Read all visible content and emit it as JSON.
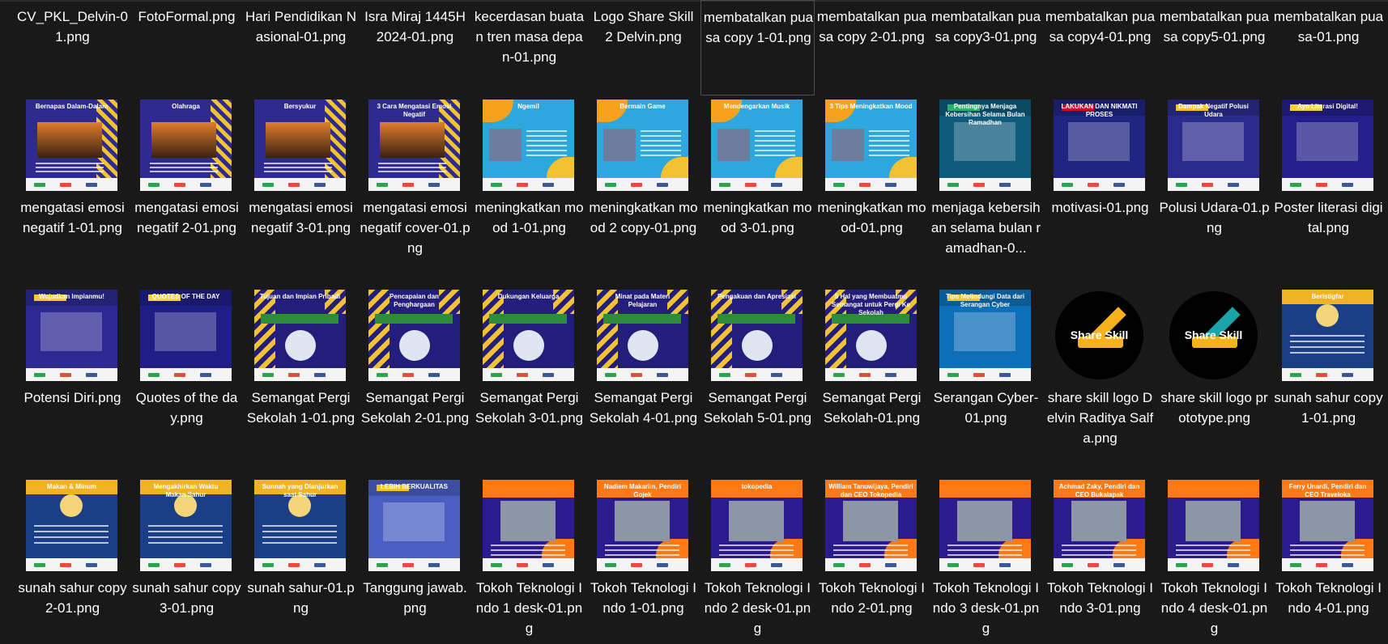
{
  "colors": {
    "background": "#191919",
    "text": "#ffffff",
    "selected_border": "#4d4d4d"
  },
  "top_row": [
    {
      "name": "CV_PKL_Delvin-01.png"
    },
    {
      "name": "FotoFormal.png"
    },
    {
      "name": "Hari Pendidikan Nasional-01.png"
    },
    {
      "name": "Isra Miraj 1445H 2024-01.png"
    },
    {
      "name": "kecerdasan buatan tren masa depan-01.png"
    },
    {
      "name": "Logo Share Skill 2 Delvin.png"
    },
    {
      "name": "membatalkan puasa copy 1-01.png",
      "selected": true
    },
    {
      "name": "membatalkan puasa copy 2-01.png"
    },
    {
      "name": "membatalkan puasa copy3-01.png"
    },
    {
      "name": "membatalkan puasa copy4-01.png"
    },
    {
      "name": "membatalkan puasa copy5-01.png"
    },
    {
      "name": "membatalkan puasa-01.png"
    }
  ],
  "row2": [
    {
      "name": "mengatasi emosi negatif 1-01.png",
      "thumb_text": "Bernapas Dalam-Dalam",
      "theme": "emosi"
    },
    {
      "name": "mengatasi emosi negatif 2-01.png",
      "thumb_text": "Olahraga",
      "theme": "emosi"
    },
    {
      "name": "mengatasi emosi negatif 3-01.png",
      "thumb_text": "Bersyukur",
      "theme": "emosi"
    },
    {
      "name": "mengatasi emosi negatif cover-01.png",
      "thumb_text": "3 Cara Mengatasi Emosi Negatif",
      "theme": "emosi"
    },
    {
      "name": "meningkatkan mood 1-01.png",
      "thumb_text": "Ngemil",
      "theme": "mood"
    },
    {
      "name": "meningkatkan mood 2 copy-01.png",
      "thumb_text": "Bermain Game",
      "theme": "mood"
    },
    {
      "name": "meningkatkan mood 3-01.png",
      "thumb_text": "Mendengarkan Musik",
      "theme": "mood"
    },
    {
      "name": "meningkatkan mood-01.png",
      "thumb_text": "3 Tips Meningkatkan Mood",
      "theme": "mood"
    },
    {
      "name": "menjaga kebersihan selama bulan ramadhan-0...",
      "thumb_text": "Pentingnya Menjaga Kebersihan Selama Bulan Ramadhan",
      "theme": "ramadhan"
    },
    {
      "name": "motivasi-01.png",
      "thumb_text": "LAKUKAN DAN NIKMATI PROSES",
      "theme": "motivasi"
    },
    {
      "name": "Polusi Udara-01.png",
      "thumb_text": "Dampak Negatif Polusi Udara",
      "theme": "polusi"
    },
    {
      "name": "Poster literasi digital.png",
      "thumb_text": "Ayo Literasi Digital!",
      "theme": "literasi"
    }
  ],
  "row3": [
    {
      "name": "Potensi Diri.png",
      "thumb_text": "Wujudkan Impianmu!",
      "theme": "potensi"
    },
    {
      "name": "Quotes of the day.png",
      "thumb_text": "QUOTES OF THE DAY",
      "theme": "quotes"
    },
    {
      "name": "Semangat Pergi Sekolah 1-01.png",
      "thumb_text": "Tujuan dan Impian Pribadi",
      "theme": "sekolah"
    },
    {
      "name": "Semangat Pergi Sekolah 2-01.png",
      "thumb_text": "Pencapaian dan Penghargaan",
      "theme": "sekolah"
    },
    {
      "name": "Semangat Pergi Sekolah 3-01.png",
      "thumb_text": "Dukungan Keluarga",
      "theme": "sekolah"
    },
    {
      "name": "Semangat Pergi Sekolah 4-01.png",
      "thumb_text": "Minat pada Materi Pelajaran",
      "theme": "sekolah"
    },
    {
      "name": "Semangat Pergi Sekolah 5-01.png",
      "thumb_text": "Pengakuan dan Apresiasi",
      "theme": "sekolah"
    },
    {
      "name": "Semangat Pergi Sekolah-01.png",
      "thumb_text": "5 Hal yang Membuatmu Semangat untuk Pergi Ke Sekolah",
      "theme": "sekolah"
    },
    {
      "name": "Serangan Cyber-01.png",
      "thumb_text": "Tips Melindungi Data dari Serangan Cyber",
      "theme": "cyber"
    },
    {
      "name": "share skill logo Delvin Raditya Salfa.png",
      "thumb_text": "Share Skill",
      "theme": "logo"
    },
    {
      "name": "share skill logo prototype.png",
      "thumb_text": "Share Skill",
      "theme": "logo"
    },
    {
      "name": "sunah sahur copy 1-01.png",
      "thumb_text": "Beristigfar",
      "theme": "sahur"
    }
  ],
  "row4": [
    {
      "name": "sunah sahur copy 2-01.png",
      "thumb_text": "Makan & Minum",
      "theme": "sahur"
    },
    {
      "name": "sunah sahur copy 3-01.png",
      "thumb_text": "Mengakhirkan Waktu Makan Sahur",
      "theme": "sahur"
    },
    {
      "name": "sunah sahur-01.png",
      "thumb_text": "Sunnah yang Dianjurkan saat Sahur",
      "theme": "sahur"
    },
    {
      "name": "Tanggung jawab.png",
      "thumb_text": "LEBIH BERKUALITAS",
      "theme": "tanggung"
    },
    {
      "name": "Tokoh Teknologi Indo 1 desk-01.png",
      "thumb_text": "",
      "theme": "tokoh"
    },
    {
      "name": "Tokoh Teknologi Indo 1-01.png",
      "thumb_text": "Nadiem Makarim, Pendiri Gojek",
      "theme": "tokoh"
    },
    {
      "name": "Tokoh Teknologi Indo 2 desk-01.png",
      "thumb_text": "tokopedia",
      "theme": "tokoh"
    },
    {
      "name": "Tokoh Teknologi Indo 2-01.png",
      "thumb_text": "William Tanuwijaya, Pendiri dan CEO Tokopedia",
      "theme": "tokoh"
    },
    {
      "name": "Tokoh Teknologi Indo 3 desk-01.png",
      "thumb_text": "",
      "theme": "tokoh"
    },
    {
      "name": "Tokoh Teknologi Indo 3-01.png",
      "thumb_text": "Achmad Zaky, Pendiri dan CEO Bukalapak",
      "theme": "tokoh"
    },
    {
      "name": "Tokoh Teknologi Indo 4 desk-01.png",
      "thumb_text": "",
      "theme": "tokoh"
    },
    {
      "name": "Tokoh Teknologi Indo 4-01.png",
      "thumb_text": "Ferry Unardi, Pendiri dan CEO Traveloka",
      "theme": "tokoh"
    }
  ]
}
